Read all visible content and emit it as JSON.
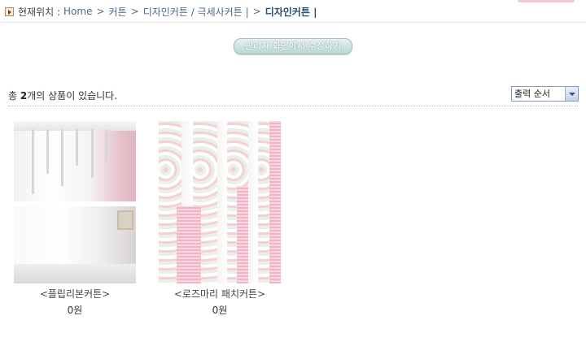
{
  "breadcrumb": {
    "label": "현재위치 :",
    "home": "Home",
    "category": "커튼",
    "subcategory": "디자인커튼 / 극세사커튼 |",
    "current": "디자인커튼 |",
    "separator": ">"
  },
  "admin_button": {
    "label": "관리자 화면에서 수정하기"
  },
  "listing": {
    "count_prefix": "총",
    "count": "2",
    "count_suffix": "개의 상품이 있습니다.",
    "sort": {
      "selected": "출력 순서"
    }
  },
  "products": [
    {
      "name": "<플립리본커튼>",
      "price": "0원"
    },
    {
      "name": "<로즈마리 패치커튼>",
      "price": "0원"
    }
  ]
}
